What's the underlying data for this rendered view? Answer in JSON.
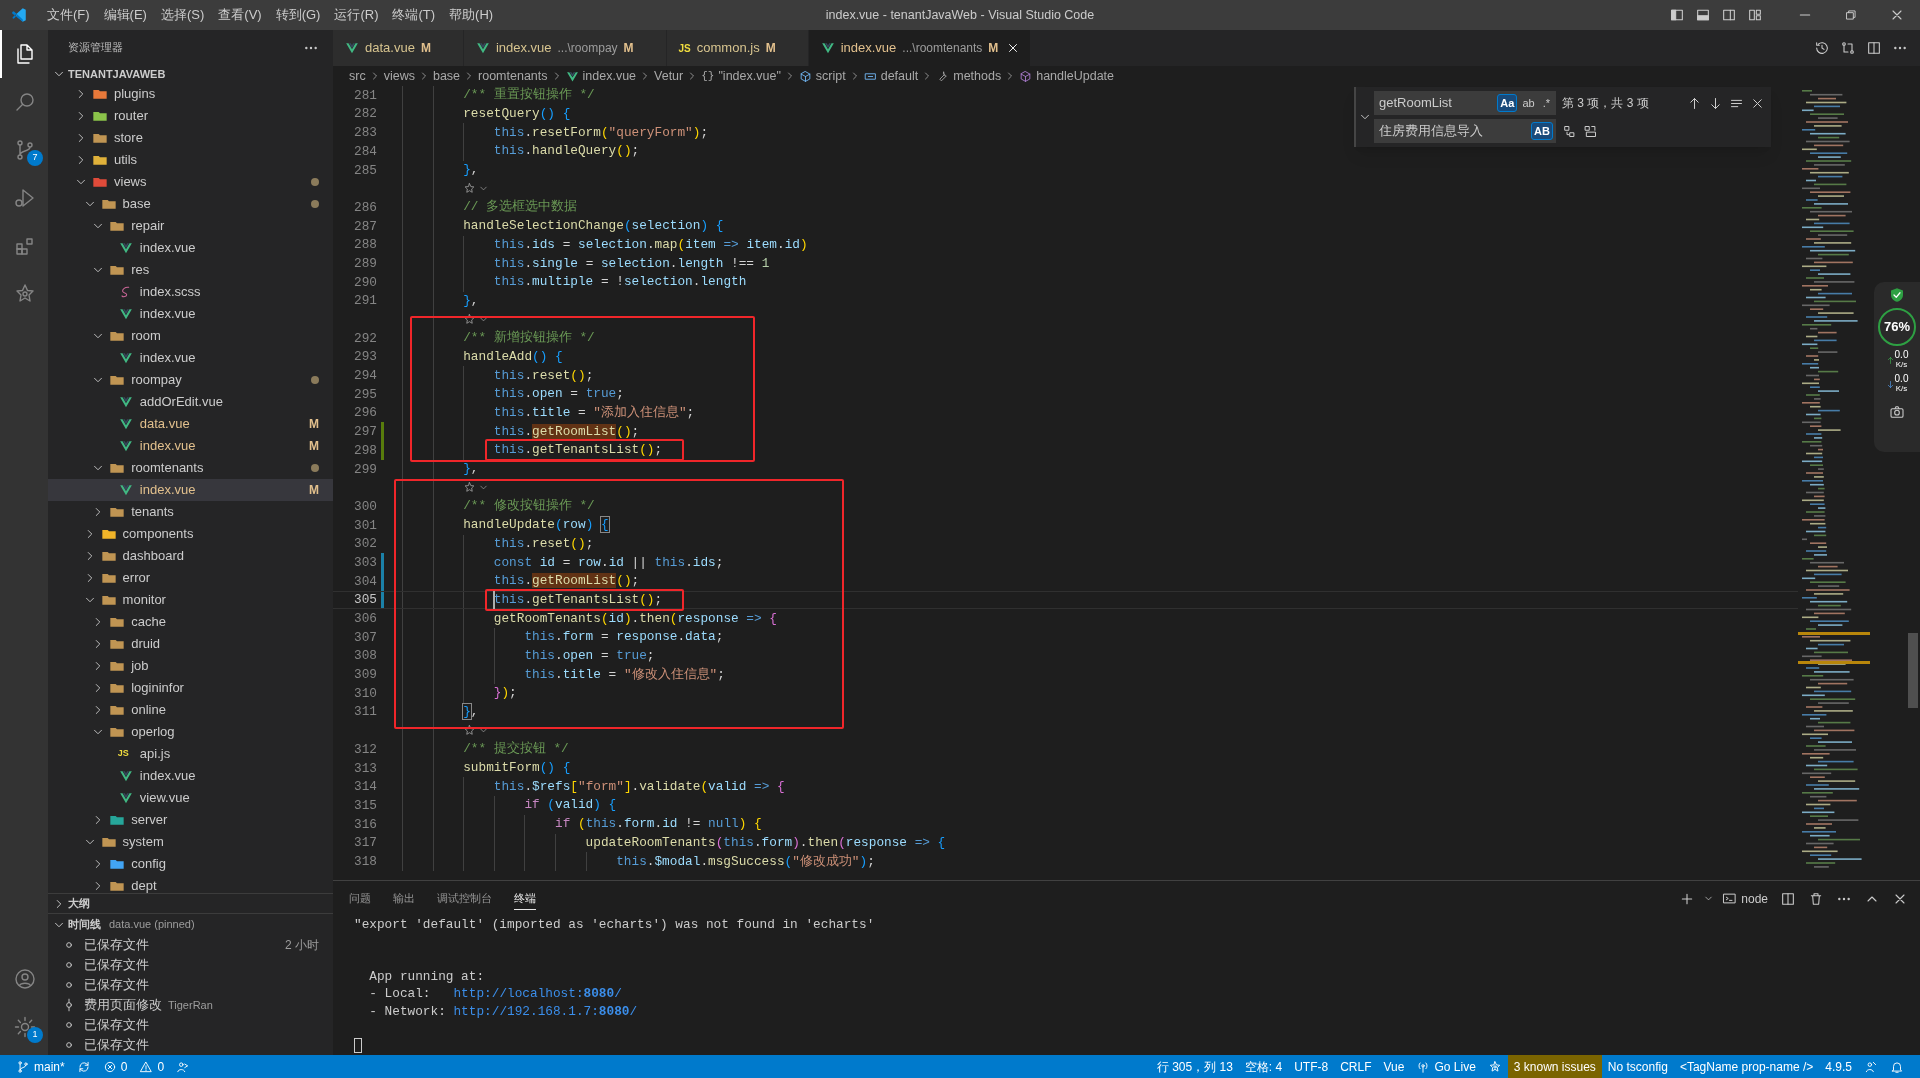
{
  "title_bar": {
    "menus": [
      "文件(F)",
      "编辑(E)",
      "选择(S)",
      "查看(V)",
      "转到(G)",
      "运行(R)",
      "终端(T)",
      "帮助(H)"
    ],
    "title": "index.vue - tenantJavaWeb - Visual Studio Code"
  },
  "activity_bar": {
    "top": [
      {
        "kind": "files",
        "selected": true
      },
      {
        "kind": "search",
        "selected": false
      },
      {
        "kind": "source-control",
        "badge": "7",
        "selected": false
      },
      {
        "kind": "run-debug",
        "selected": false
      },
      {
        "kind": "extensions",
        "selected": false
      },
      {
        "kind": "star",
        "selected": false
      }
    ],
    "bottom": [
      {
        "kind": "account",
        "selected": false
      },
      {
        "kind": "settings",
        "badge": "1",
        "selected": false
      }
    ]
  },
  "explorer": {
    "title": "资源管理器",
    "root": "TENANTJAVAWEB",
    "tree": [
      {
        "name": "plugins",
        "kind": "folder",
        "color": "#e8793a",
        "expanded": false,
        "selected": false
      },
      {
        "name": "router",
        "kind": "folder",
        "color": "#8bc34a",
        "expanded": false,
        "selected": false
      },
      {
        "name": "store",
        "kind": "folder",
        "color": "#c09553",
        "expanded": false,
        "selected": false
      },
      {
        "name": "utils",
        "kind": "folder",
        "color": "#e0b13a",
        "expanded": false,
        "selected": false
      },
      {
        "name": "views",
        "kind": "folder",
        "color": "#e04b3a",
        "expanded": true,
        "dot": true,
        "selected": false,
        "children": [
          {
            "name": "base",
            "kind": "folder",
            "color": "#c09553",
            "expanded": true,
            "dot": true,
            "selected": false,
            "children": [
              {
                "name": "repair",
                "kind": "folder",
                "color": "#c09553",
                "expanded": true,
                "selected": false,
                "children": [
                  {
                    "name": "index.vue",
                    "kind": "vue",
                    "selected": false
                  }
                ]
              },
              {
                "name": "res",
                "kind": "folder",
                "color": "#c09553",
                "expanded": true,
                "selected": false,
                "children": [
                  {
                    "name": "index.scss",
                    "kind": "scss",
                    "selected": false
                  },
                  {
                    "name": "index.vue",
                    "kind": "vue",
                    "selected": false
                  }
                ]
              },
              {
                "name": "room",
                "kind": "folder",
                "color": "#c09553",
                "expanded": true,
                "selected": false,
                "children": [
                  {
                    "name": "index.vue",
                    "kind": "vue",
                    "selected": false
                  }
                ]
              },
              {
                "name": "roompay",
                "kind": "folder",
                "color": "#c09553",
                "expanded": true,
                "dot": true,
                "selected": false,
                "children": [
                  {
                    "name": "addOrEdit.vue",
                    "kind": "vue",
                    "selected": false
                  },
                  {
                    "name": "data.vue",
                    "kind": "vue",
                    "badge": "M",
                    "selected": false
                  },
                  {
                    "name": "index.vue",
                    "kind": "vue",
                    "badge": "M",
                    "selected": false
                  }
                ]
              },
              {
                "name": "roomtenants",
                "kind": "folder",
                "color": "#c09553",
                "expanded": true,
                "dot": true,
                "selected": false,
                "children": [
                  {
                    "name": "index.vue",
                    "kind": "vue",
                    "badge": "M",
                    "selected": true
                  }
                ]
              },
              {
                "name": "tenants",
                "kind": "folder",
                "color": "#c09553",
                "expanded": false,
                "selected": false
              }
            ]
          },
          {
            "name": "components",
            "kind": "folder",
            "color": "#f0b429",
            "expanded": false,
            "selected": false
          },
          {
            "name": "dashboard",
            "kind": "folder",
            "color": "#c09553",
            "expanded": false,
            "selected": false
          },
          {
            "name": "error",
            "kind": "folder",
            "color": "#c09553",
            "expanded": false,
            "selected": false
          },
          {
            "name": "monitor",
            "kind": "folder",
            "color": "#c09553",
            "expanded": true,
            "selected": false,
            "children": [
              {
                "name": "cache",
                "kind": "folder",
                "color": "#c09553",
                "expanded": false,
                "selected": false
              },
              {
                "name": "druid",
                "kind": "folder",
                "color": "#c09553",
                "expanded": false,
                "selected": false
              },
              {
                "name": "job",
                "kind": "folder",
                "color": "#c09553",
                "expanded": false,
                "selected": false
              },
              {
                "name": "logininfor",
                "kind": "folder",
                "color": "#c09553",
                "expanded": false,
                "selected": false
              },
              {
                "name": "online",
                "kind": "folder",
                "color": "#c09553",
                "expanded": false,
                "selected": false
              },
              {
                "name": "operlog",
                "kind": "folder",
                "color": "#c09553",
                "expanded": true,
                "selected": false,
                "children": [
                  {
                    "name": "api.js",
                    "kind": "js",
                    "icon_text": "JS",
                    "selected": false
                  },
                  {
                    "name": "index.vue",
                    "kind": "vue",
                    "selected": false
                  },
                  {
                    "name": "view.vue",
                    "kind": "vue",
                    "selected": false
                  }
                ]
              },
              {
                "name": "server",
                "kind": "folder",
                "color": "#26a69a",
                "expanded": false,
                "selected": false
              }
            ]
          },
          {
            "name": "system",
            "kind": "folder",
            "color": "#c09553",
            "expanded": true,
            "selected": false,
            "children": [
              {
                "name": "config",
                "kind": "folder",
                "color": "#42a5f5",
                "expanded": false,
                "selected": false
              },
              {
                "name": "dept",
                "kind": "folder",
                "color": "#c09553",
                "expanded": false,
                "selected": false
              }
            ]
          }
        ]
      }
    ],
    "outline": {
      "title": "大纲",
      "expanded": false
    },
    "timeline": {
      "title": "时间线",
      "detail": "data.vue (pinned)",
      "expanded": true,
      "items": [
        {
          "kind": "save",
          "label": "已保存文件",
          "time": "2 小时"
        },
        {
          "kind": "save",
          "label": "已保存文件"
        },
        {
          "kind": "save",
          "label": "已保存文件"
        },
        {
          "kind": "commit",
          "label": "费用页面修改",
          "author": "TigerRan"
        },
        {
          "kind": "save",
          "label": "已保存文件"
        },
        {
          "kind": "save",
          "label": "已保存文件"
        }
      ]
    }
  },
  "tabs": [
    {
      "name": "data.vue",
      "kind": "vue",
      "badge": "M",
      "selected": false
    },
    {
      "name": "index.vue",
      "hint": "...\\roompay",
      "kind": "vue",
      "badge": "M",
      "selected": false
    },
    {
      "name": "common.js",
      "kind": "js",
      "icon_text": "JS",
      "badge": "M",
      "selected": false
    },
    {
      "name": "index.vue",
      "hint": "...\\roomtenants",
      "kind": "vue",
      "badge": "M",
      "selected": true
    }
  ],
  "breadcrumb": [
    {
      "label": "src"
    },
    {
      "label": "views"
    },
    {
      "label": "base"
    },
    {
      "label": "roomtenants"
    },
    {
      "label": "index.vue",
      "kind": "vue"
    },
    {
      "label": "Vetur"
    },
    {
      "label": "\"index.vue\"",
      "icon_text": "{}"
    },
    {
      "label": "script",
      "kind": "cube"
    },
    {
      "label": "default",
      "kind": "variable"
    },
    {
      "label": "methods",
      "kind": "wrench"
    },
    {
      "label": "handleUpdate",
      "kind": "method"
    }
  ],
  "code": [
    {
      "number": "281",
      "tokens": [
        {
          "kind": "comment",
          "text": "        /** 重置按钮操作 */"
        }
      ]
    },
    {
      "number": "282",
      "tokens": [
        {
          "kind": "function",
          "text": "        resetQuery"
        },
        {
          "kind": "bracket-1",
          "text": "() {"
        }
      ]
    },
    {
      "number": "283",
      "tokens": [
        {
          "kind": "keyword",
          "text": "            this"
        },
        {
          "kind": "plain",
          "text": "."
        },
        {
          "kind": "function",
          "text": "resetForm"
        },
        {
          "kind": "bracket-2",
          "text": "("
        },
        {
          "kind": "string",
          "text": "\"queryForm\""
        },
        {
          "kind": "bracket-2",
          "text": ")"
        },
        {
          "kind": "plain",
          "text": ";"
        }
      ]
    },
    {
      "number": "284",
      "tokens": [
        {
          "kind": "keyword",
          "text": "            this"
        },
        {
          "kind": "plain",
          "text": "."
        },
        {
          "kind": "function",
          "text": "handleQuery"
        },
        {
          "kind": "bracket-2",
          "text": "()"
        },
        {
          "kind": "plain",
          "text": ";"
        }
      ]
    },
    {
      "number": "285",
      "tokens": [
        {
          "kind": "bracket-1",
          "text": "        }"
        },
        {
          "kind": "plain",
          "text": ","
        }
      ]
    },
    {
      "kind": "lens"
    },
    {
      "number": "286",
      "tokens": [
        {
          "kind": "comment",
          "text": "        // 多选框选中数据"
        }
      ]
    },
    {
      "number": "287",
      "tokens": [
        {
          "kind": "function",
          "text": "        handleSelectionChange"
        },
        {
          "kind": "bracket-1",
          "text": "("
        },
        {
          "kind": "variable",
          "text": "selection"
        },
        {
          "kind": "bracket-1",
          "text": ") {"
        }
      ]
    },
    {
      "number": "288",
      "tokens": [
        {
          "kind": "keyword",
          "text": "            this"
        },
        {
          "kind": "plain",
          "text": "."
        },
        {
          "kind": "variable",
          "text": "ids"
        },
        {
          "kind": "plain",
          "text": " = "
        },
        {
          "kind": "variable",
          "text": "selection"
        },
        {
          "kind": "plain",
          "text": "."
        },
        {
          "kind": "function",
          "text": "map"
        },
        {
          "kind": "bracket-2",
          "text": "("
        },
        {
          "kind": "variable",
          "text": "item"
        },
        {
          "kind": "keyword",
          "text": " => "
        },
        {
          "kind": "variable",
          "text": "item"
        },
        {
          "kind": "plain",
          "text": "."
        },
        {
          "kind": "variable",
          "text": "id"
        },
        {
          "kind": "bracket-2",
          "text": ")"
        }
      ]
    },
    {
      "number": "289",
      "tokens": [
        {
          "kind": "keyword",
          "text": "            this"
        },
        {
          "kind": "plain",
          "text": "."
        },
        {
          "kind": "variable",
          "text": "single"
        },
        {
          "kind": "plain",
          "text": " = "
        },
        {
          "kind": "variable",
          "text": "selection"
        },
        {
          "kind": "plain",
          "text": "."
        },
        {
          "kind": "variable",
          "text": "length"
        },
        {
          "kind": "plain",
          "text": " !== "
        },
        {
          "kind": "number",
          "text": "1"
        }
      ]
    },
    {
      "number": "290",
      "tokens": [
        {
          "kind": "keyword",
          "text": "            this"
        },
        {
          "kind": "plain",
          "text": "."
        },
        {
          "kind": "variable",
          "text": "multiple"
        },
        {
          "kind": "plain",
          "text": " = !"
        },
        {
          "kind": "variable",
          "text": "selection"
        },
        {
          "kind": "plain",
          "text": "."
        },
        {
          "kind": "variable",
          "text": "length"
        }
      ]
    },
    {
      "number": "291",
      "tokens": [
        {
          "kind": "bracket-1",
          "text": "        }"
        },
        {
          "kind": "plain",
          "text": ","
        }
      ]
    },
    {
      "kind": "lens"
    },
    {
      "number": "292",
      "tokens": [
        {
          "kind": "comment",
          "text": "        /** 新增按钮操作 */"
        }
      ]
    },
    {
      "number": "293",
      "tokens": [
        {
          "kind": "function",
          "text": "        handleAdd"
        },
        {
          "kind": "bracket-1",
          "text": "() {"
        }
      ]
    },
    {
      "number": "294",
      "tokens": [
        {
          "kind": "keyword",
          "text": "            this"
        },
        {
          "kind": "plain",
          "text": "."
        },
        {
          "kind": "function",
          "text": "reset"
        },
        {
          "kind": "bracket-2",
          "text": "()"
        },
        {
          "kind": "plain",
          "text": ";"
        }
      ]
    },
    {
      "number": "295",
      "tokens": [
        {
          "kind": "keyword",
          "text": "            this"
        },
        {
          "kind": "plain",
          "text": "."
        },
        {
          "kind": "variable",
          "text": "open"
        },
        {
          "kind": "plain",
          "text": " = "
        },
        {
          "kind": "keyword",
          "text": "true"
        },
        {
          "kind": "plain",
          "text": ";"
        }
      ]
    },
    {
      "number": "296",
      "tokens": [
        {
          "kind": "keyword",
          "text": "            this"
        },
        {
          "kind": "plain",
          "text": "."
        },
        {
          "kind": "variable",
          "text": "title"
        },
        {
          "kind": "plain",
          "text": " = "
        },
        {
          "kind": "string",
          "text": "\"添加入住信息\""
        },
        {
          "kind": "plain",
          "text": ";"
        }
      ]
    },
    {
      "number": "297",
      "added": true,
      "tokens": [
        {
          "kind": "keyword",
          "text": "            this"
        },
        {
          "kind": "plain",
          "text": "."
        },
        {
          "kind": "find-match",
          "text": "getRoomList"
        },
        {
          "kind": "bracket-2",
          "text": "()"
        },
        {
          "kind": "plain",
          "text": ";"
        }
      ]
    },
    {
      "number": "298",
      "added": true,
      "framed": true,
      "tokens": [
        {
          "kind": "keyword",
          "text": "            this"
        },
        {
          "kind": "plain",
          "text": "."
        },
        {
          "kind": "function",
          "text": "getTenantsList"
        },
        {
          "kind": "bracket-2",
          "text": "()"
        },
        {
          "kind": "plain",
          "text": ";"
        }
      ]
    },
    {
      "number": "299",
      "tokens": [
        {
          "kind": "bracket-1",
          "text": "        }"
        },
        {
          "kind": "plain",
          "text": ","
        }
      ]
    },
    {
      "kind": "lens"
    },
    {
      "number": "300",
      "tokens": [
        {
          "kind": "comment",
          "text": "        /** 修改按钮操作 */"
        }
      ]
    },
    {
      "number": "301",
      "tokens": [
        {
          "kind": "function",
          "text": "        handleUpdate"
        },
        {
          "kind": "bracket-1",
          "text": "("
        },
        {
          "kind": "variable",
          "text": "row"
        },
        {
          "kind": "bracket-1",
          "text": ") "
        },
        {
          "kind": "bracket-pair",
          "text": "{"
        }
      ]
    },
    {
      "number": "302",
      "tokens": [
        {
          "kind": "keyword",
          "text": "            this"
        },
        {
          "kind": "plain",
          "text": "."
        },
        {
          "kind": "function",
          "text": "reset"
        },
        {
          "kind": "bracket-2",
          "text": "()"
        },
        {
          "kind": "plain",
          "text": ";"
        }
      ]
    },
    {
      "number": "303",
      "modified": true,
      "tokens": [
        {
          "kind": "keyword",
          "text": "            const"
        },
        {
          "kind": "variable",
          "text": " id"
        },
        {
          "kind": "plain",
          "text": " = "
        },
        {
          "kind": "variable",
          "text": "row"
        },
        {
          "kind": "plain",
          "text": "."
        },
        {
          "kind": "variable",
          "text": "id"
        },
        {
          "kind": "plain",
          "text": " || "
        },
        {
          "kind": "keyword",
          "text": "this"
        },
        {
          "kind": "plain",
          "text": "."
        },
        {
          "kind": "variable",
          "text": "ids"
        },
        {
          "kind": "plain",
          "text": ";"
        }
      ]
    },
    {
      "number": "304",
      "modified": true,
      "tokens": [
        {
          "kind": "keyword",
          "text": "            this"
        },
        {
          "kind": "plain",
          "text": "."
        },
        {
          "kind": "find-match",
          "text": "getRoomList"
        },
        {
          "kind": "bracket-2",
          "text": "()"
        },
        {
          "kind": "plain",
          "text": ";"
        }
      ]
    },
    {
      "number": "305",
      "modified": true,
      "framed": true,
      "current": true,
      "tokens": [
        {
          "kind": "keyword",
          "text": "            this"
        },
        {
          "kind": "plain",
          "text": "."
        },
        {
          "kind": "function",
          "text": "getTenantsList"
        },
        {
          "kind": "bracket-2",
          "text": "()"
        },
        {
          "kind": "plain",
          "text": ";"
        }
      ]
    },
    {
      "number": "306",
      "tokens": [
        {
          "kind": "function",
          "text": "            getRoomTenants"
        },
        {
          "kind": "bracket-2",
          "text": "("
        },
        {
          "kind": "variable",
          "text": "id"
        },
        {
          "kind": "bracket-2",
          "text": ")"
        },
        {
          "kind": "plain",
          "text": "."
        },
        {
          "kind": "function",
          "text": "then"
        },
        {
          "kind": "bracket-2",
          "text": "("
        },
        {
          "kind": "variable",
          "text": "response"
        },
        {
          "kind": "keyword",
          "text": " => "
        },
        {
          "kind": "bracket-3",
          "text": "{"
        }
      ]
    },
    {
      "number": "307",
      "tokens": [
        {
          "kind": "keyword",
          "text": "                this"
        },
        {
          "kind": "plain",
          "text": "."
        },
        {
          "kind": "variable",
          "text": "form"
        },
        {
          "kind": "plain",
          "text": " = "
        },
        {
          "kind": "variable",
          "text": "response"
        },
        {
          "kind": "plain",
          "text": "."
        },
        {
          "kind": "variable",
          "text": "data"
        },
        {
          "kind": "plain",
          "text": ";"
        }
      ]
    },
    {
      "number": "308",
      "tokens": [
        {
          "kind": "keyword",
          "text": "                this"
        },
        {
          "kind": "plain",
          "text": "."
        },
        {
          "kind": "variable",
          "text": "open"
        },
        {
          "kind": "plain",
          "text": " = "
        },
        {
          "kind": "keyword",
          "text": "true"
        },
        {
          "kind": "plain",
          "text": ";"
        }
      ]
    },
    {
      "number": "309",
      "tokens": [
        {
          "kind": "keyword",
          "text": "                this"
        },
        {
          "kind": "plain",
          "text": "."
        },
        {
          "kind": "variable",
          "text": "title"
        },
        {
          "kind": "plain",
          "text": " = "
        },
        {
          "kind": "string",
          "text": "\"修改入住信息\""
        },
        {
          "kind": "plain",
          "text": ";"
        }
      ]
    },
    {
      "number": "310",
      "tokens": [
        {
          "kind": "bracket-3",
          "text": "            }"
        },
        {
          "kind": "bracket-2",
          "text": ")"
        },
        {
          "kind": "plain",
          "text": ";"
        }
      ]
    },
    {
      "number": "311",
      "tokens": [
        {
          "kind": "bracket-pair",
          "text": "        }"
        },
        {
          "kind": "plain",
          "text": ","
        }
      ]
    },
    {
      "kind": "lens"
    },
    {
      "number": "312",
      "tokens": [
        {
          "kind": "comment",
          "text": "        /** 提交按钮 */"
        }
      ]
    },
    {
      "number": "313",
      "tokens": [
        {
          "kind": "function",
          "text": "        submitForm"
        },
        {
          "kind": "bracket-1",
          "text": "() {"
        }
      ]
    },
    {
      "number": "314",
      "tokens": [
        {
          "kind": "keyword",
          "text": "            this"
        },
        {
          "kind": "plain",
          "text": "."
        },
        {
          "kind": "variable",
          "text": "$refs"
        },
        {
          "kind": "bracket-2",
          "text": "["
        },
        {
          "kind": "string",
          "text": "\"form\""
        },
        {
          "kind": "bracket-2",
          "text": "]"
        },
        {
          "kind": "plain",
          "text": "."
        },
        {
          "kind": "function",
          "text": "validate"
        },
        {
          "kind": "bracket-2",
          "text": "("
        },
        {
          "kind": "variable",
          "text": "valid"
        },
        {
          "kind": "keyword",
          "text": " => "
        },
        {
          "kind": "bracket-3",
          "text": "{"
        }
      ]
    },
    {
      "number": "315",
      "tokens": [
        {
          "kind": "control",
          "text": "                if"
        },
        {
          "kind": "bracket-1",
          "text": " ("
        },
        {
          "kind": "variable",
          "text": "valid"
        },
        {
          "kind": "bracket-1",
          "text": ") {"
        }
      ]
    },
    {
      "number": "316",
      "tokens": [
        {
          "kind": "control",
          "text": "                    if"
        },
        {
          "kind": "bracket-2",
          "text": " ("
        },
        {
          "kind": "keyword",
          "text": "this"
        },
        {
          "kind": "plain",
          "text": "."
        },
        {
          "kind": "variable",
          "text": "form"
        },
        {
          "kind": "plain",
          "text": "."
        },
        {
          "kind": "variable",
          "text": "id"
        },
        {
          "kind": "plain",
          "text": " != "
        },
        {
          "kind": "keyword",
          "text": "null"
        },
        {
          "kind": "bracket-2",
          "text": ") {"
        }
      ]
    },
    {
      "number": "317",
      "tokens": [
        {
          "kind": "function",
          "text": "                        updateRoomTenants"
        },
        {
          "kind": "bracket-3",
          "text": "("
        },
        {
          "kind": "keyword",
          "text": "this"
        },
        {
          "kind": "plain",
          "text": "."
        },
        {
          "kind": "variable",
          "text": "form"
        },
        {
          "kind": "bracket-3",
          "text": ")"
        },
        {
          "kind": "plain",
          "text": "."
        },
        {
          "kind": "function",
          "text": "then"
        },
        {
          "kind": "bracket-3",
          "text": "("
        },
        {
          "kind": "variable",
          "text": "response"
        },
        {
          "kind": "keyword",
          "text": " => "
        },
        {
          "kind": "bracket-1",
          "text": "{"
        }
      ]
    },
    {
      "number": "318",
      "tokens": [
        {
          "kind": "keyword",
          "text": "                            this"
        },
        {
          "kind": "plain",
          "text": "."
        },
        {
          "kind": "variable",
          "text": "$modal"
        },
        {
          "kind": "plain",
          "text": "."
        },
        {
          "kind": "function",
          "text": "msgSuccess"
        },
        {
          "kind": "bracket-1",
          "text": "("
        },
        {
          "kind": "string",
          "text": "\"修改成功\""
        },
        {
          "kind": "bracket-1",
          "text": ")"
        },
        {
          "kind": "plain",
          "text": ";"
        }
      ]
    }
  ],
  "marked_boxes": [
    {
      "kind": "frame"
    },
    {
      "kind": "frame"
    }
  ],
  "find_widget": {
    "expanded": true,
    "find": {
      "value": "getRoomList",
      "options": [
        {
          "label": "Aa",
          "on": true
        },
        {
          "label": "ab",
          "on": false
        },
        {
          "label": ".*",
          "on": false
        }
      ]
    },
    "result": "第 3 项，共 3 项",
    "replace": {
      "value": "住房费用信息导入",
      "options": [
        {
          "label": "AB",
          "on": true
        }
      ]
    }
  },
  "monitor_widget": {
    "percent": "76%",
    "upload": {
      "value": "0.0",
      "unit": "K/s"
    },
    "download": {
      "value": "0.0",
      "unit": "K/s"
    }
  },
  "panel": {
    "tabs": [
      {
        "label": "问题",
        "selected": false
      },
      {
        "label": "输出",
        "selected": false
      },
      {
        "label": "调试控制台",
        "selected": false
      },
      {
        "label": "终端",
        "selected": true
      }
    ],
    "shell": "node",
    "terminal": [
      {
        "kind": "text",
        "text": "\"export 'default' (imported as 'echarts') was not found in 'echarts'"
      },
      {
        "kind": "blank"
      },
      {
        "kind": "blank"
      },
      {
        "kind": "text",
        "text": "  App running at:"
      },
      {
        "kind": "link",
        "text": "  - Local:   ",
        "link": "http://localhost:**8080**/"
      },
      {
        "kind": "link",
        "text": "  - Network: ",
        "link": "http://192.168.1.7:**8080**/"
      },
      {
        "kind": "blank"
      },
      {
        "kind": "cursor"
      }
    ]
  },
  "status_bar": {
    "left": [
      {
        "kind": "branch",
        "text": "main*"
      },
      {
        "kind": "sync"
      },
      {
        "kind": "error",
        "text": "0"
      },
      {
        "kind": "warning",
        "text": "0"
      },
      {
        "kind": "share"
      }
    ],
    "right": [
      {
        "text": "行 305，列 13"
      },
      {
        "text": "空格: 4"
      },
      {
        "text": "UTF-8"
      },
      {
        "text": "CRLF"
      },
      {
        "text": "Vue"
      },
      {
        "kind": "broadcast",
        "text": "Go Live"
      },
      {
        "kind": "star"
      },
      {
        "text": "3 known issues",
        "kind": "issues"
      },
      {
        "text": "No tsconfig"
      },
      {
        "text": "<TagName prop-name />"
      },
      {
        "text": "4.9.5"
      },
      {
        "kind": "feedback"
      },
      {
        "kind": "bell"
      }
    ]
  }
}
